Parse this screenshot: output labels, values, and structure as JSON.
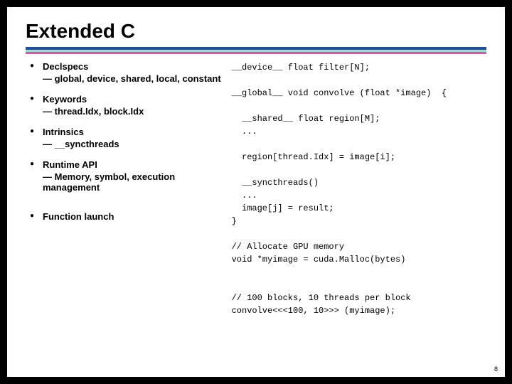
{
  "title": "Extended C",
  "bullets": [
    {
      "head": "Declspecs",
      "sub": "— global, device, shared, local, constant"
    },
    {
      "head": "Keywords",
      "sub": "— thread.Idx, block.Idx"
    },
    {
      "head": "Intrinsics",
      "sub": "— __syncthreads"
    },
    {
      "head": "Runtime API",
      "sub": "— Memory, symbol, execution management"
    },
    {
      "head": "Function launch",
      "sub": ""
    }
  ],
  "code": {
    "l1": "__device__ float filter[N];",
    "l2": "",
    "l3": "__global__ void convolve (float *image)  {",
    "l4": "",
    "l5": "  __shared__ float region[M];",
    "l6": "  ...",
    "l7": "",
    "l8": "  region[thread.Idx] = image[i];",
    "l9": "",
    "l10": "  __syncthreads()",
    "l11": "  ...",
    "l12": "  image[j] = result;",
    "l13": "}",
    "l14": "",
    "l15": "// Allocate GPU memory",
    "l16": "void *myimage = cuda.Malloc(bytes)",
    "l17": "",
    "l18": "",
    "l19": "// 100 blocks, 10 threads per block",
    "l20": "convolve<<<100, 10>>> (myimage);"
  },
  "pagenum": "8"
}
